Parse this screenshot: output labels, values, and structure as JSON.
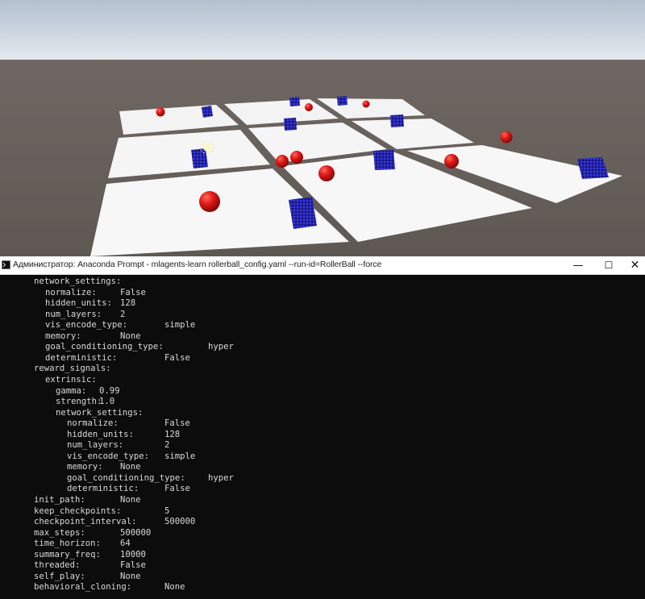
{
  "scene": {
    "sky_top": "#b9c5d3",
    "sky_horizon": "#dfe7ee",
    "ground_color": "#6d6560",
    "platform_color": "#f5f5f5",
    "divider_color": "#5e564f",
    "ball_color": "#e01818",
    "cube_color": "#1e1ea8"
  },
  "window": {
    "title": "Администратор: Anaconda Prompt - mlagents-learn  rollerball_config.yaml --run-id=RollerBall --force",
    "minimize_icon": "minimize-icon",
    "maximize_icon": "maximize-icon",
    "close_icon": "close-icon"
  },
  "console": {
    "lines": [
      {
        "key": "network_settings:",
        "value": ""
      },
      {
        "key": "normalize:",
        "value": "False"
      },
      {
        "key": "hidden_units:",
        "value": "128"
      },
      {
        "key": "num_layers:",
        "value": "2"
      },
      {
        "key": "vis_encode_type:",
        "value": "simple"
      },
      {
        "key": "memory:",
        "value": "None"
      },
      {
        "key": "goal_conditioning_type:",
        "value": "hyper"
      },
      {
        "key": "deterministic:",
        "value": "False"
      },
      {
        "key": "reward_signals:",
        "value": ""
      },
      {
        "key": "extrinsic:",
        "value": ""
      },
      {
        "key": "gamma:",
        "value": "0.99"
      },
      {
        "key": "strength:",
        "value": "1.0"
      },
      {
        "key": "network_settings:",
        "value": ""
      },
      {
        "key": "normalize:",
        "value": "False"
      },
      {
        "key": "hidden_units:",
        "value": "128"
      },
      {
        "key": "num_layers:",
        "value": "2"
      },
      {
        "key": "vis_encode_type:",
        "value": "simple"
      },
      {
        "key": "memory:",
        "value": "None"
      },
      {
        "key": "goal_conditioning_type:",
        "value": "hyper"
      },
      {
        "key": "deterministic:",
        "value": "False"
      },
      {
        "key": "init_path:",
        "value": "None"
      },
      {
        "key": "keep_checkpoints:",
        "value": "5"
      },
      {
        "key": "checkpoint_interval:",
        "value": "500000"
      },
      {
        "key": "max_steps:",
        "value": "500000"
      },
      {
        "key": "time_horizon:",
        "value": "64"
      },
      {
        "key": "summary_freq:",
        "value": "10000"
      },
      {
        "key": "threaded:",
        "value": "False"
      },
      {
        "key": "self_play:",
        "value": "None"
      },
      {
        "key": "behavioral_cloning:",
        "value": "None"
      }
    ]
  }
}
